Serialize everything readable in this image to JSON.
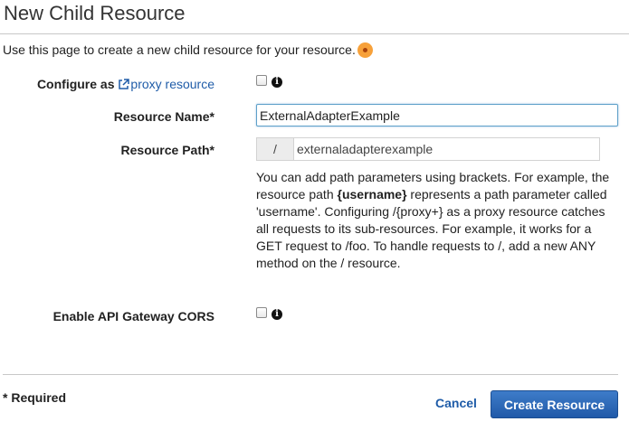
{
  "page": {
    "title": "New Child Resource",
    "intro_text": "Use this page to create a new child resource for your resource."
  },
  "form": {
    "proxy": {
      "label_prefix": "Configure as ",
      "link_text": "proxy resource",
      "checked": false
    },
    "resource_name": {
      "label": "Resource Name*",
      "value": "ExternalAdapterExample"
    },
    "resource_path": {
      "label": "Resource Path*",
      "prefix": "/",
      "value": "externaladapterexample"
    },
    "help": {
      "part1": "You can add path parameters using brackets. For example, the resource path ",
      "bold": "{username}",
      "part2": " represents a path parameter called 'username'. Configuring /{proxy+} as a proxy resource catches all requests to its sub-resources. For example, it works for a GET request to /foo. To handle requests to /, add a new ANY method on the / resource."
    },
    "cors": {
      "label": "Enable API Gateway CORS",
      "checked": false
    }
  },
  "footer": {
    "required_note": "* Required",
    "cancel_label": "Cancel",
    "create_label": "Create Resource"
  },
  "colors": {
    "link": "#1f5ca8",
    "primary_button": "#2f6bbd",
    "intro_icon": "#f7a13a"
  },
  "icons": {
    "intro": "orange-info-dot-icon",
    "info": "info-icon",
    "external_link": "external-link-icon"
  }
}
